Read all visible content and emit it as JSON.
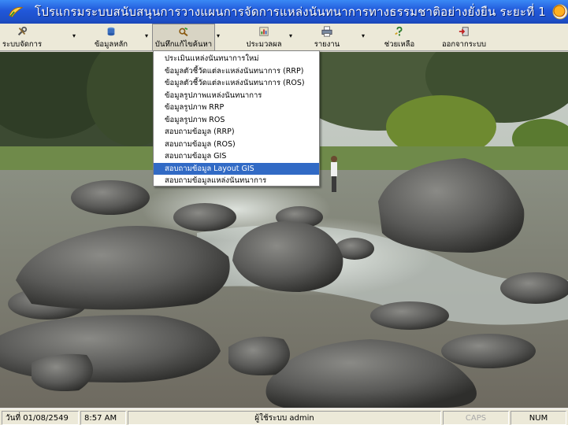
{
  "window": {
    "title": "โปรแกรมระบบสนับสนุนการวางแผนการจัดการแหล่งนันทนาการทางธรรมชาติอย่างยั่งยืน ระยะที่ 1"
  },
  "toolbar": {
    "items": [
      {
        "label": "ระบบจัดการ",
        "icon": "tools-icon"
      },
      {
        "label": "ข้อมูลหลัก",
        "icon": "database-icon"
      },
      {
        "label": "บันทึกแก้ไขค้นหา",
        "icon": "edit-search-icon"
      },
      {
        "label": "ประมวลผล",
        "icon": "process-icon"
      },
      {
        "label": "รายงาน",
        "icon": "printer-icon"
      },
      {
        "label": "ช่วยเหลือ",
        "icon": "help-icon"
      },
      {
        "label": "ออกจากระบบ",
        "icon": "exit-icon"
      }
    ]
  },
  "menu": {
    "items": [
      "ประเมินแหล่งนันทนาการใหม่",
      "ข้อมูลตัวชี้วัดแต่ละแหล่งนันทนาการ (RRP)",
      "ข้อมูลตัวชี้วัดแต่ละแหล่งนันทนาการ (ROS)",
      "ข้อมูลรูปภาพแหล่งนันทนาการ",
      "ข้อมูลรูปภาพ RRP",
      "ข้อมูลรูปภาพ ROS",
      "สอบถามข้อมูล (RRP)",
      "สอบถามข้อมูล (ROS)",
      "สอบถามข้อมูล GIS",
      "สอบถามข้อมูล Layout GIS",
      "สอบถามข้อมูลแหล่งนันทนาการ"
    ],
    "highlighted_index": 9
  },
  "statusbar": {
    "date": "วันที่ 01/08/2549",
    "time": "8:57 AM",
    "user": "ผู้ใช้ระบบ admin",
    "caps": "CAPS",
    "num": "NUM"
  },
  "colors": {
    "titlebar": "#2157d9",
    "highlight": "#316ac5"
  }
}
